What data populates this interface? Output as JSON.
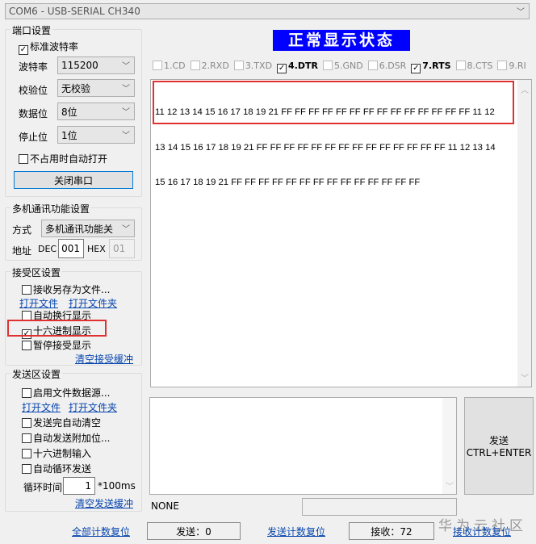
{
  "port_combo": "COM6 - USB-SERIAL CH340",
  "status_banner": "正常显示状态",
  "colors": {
    "banner_bg": "#0000ff",
    "banner_fg": "#ffffff",
    "highlight": "#e03030",
    "link": "#0645ad"
  },
  "signals": [
    {
      "label": "1.CD",
      "checked": false
    },
    {
      "label": "2.RXD",
      "checked": false
    },
    {
      "label": "3.TXD",
      "checked": false
    },
    {
      "label": "4.DTR",
      "checked": true
    },
    {
      "label": "5.GND",
      "checked": false
    },
    {
      "label": "6.DSR",
      "checked": false
    },
    {
      "label": "7.RTS",
      "checked": true
    },
    {
      "label": "8.CTS",
      "checked": false
    },
    {
      "label": "9.RI",
      "checked": false
    }
  ],
  "rx_lines": [
    "11 12 13 14 15 16 17 18 19 21 FF FF FF FF FF FF FF FF FF FF FF FF FF FF 11 12",
    "13 14 15 16 17 18 19 21 FF FF FF FF FF FF FF FF FF FF FF FF FF FF 11 12 13 14",
    "15 16 17 18 19 21 FF FF FF FF FF FF FF FF FF FF FF FF FF FF"
  ],
  "port": {
    "title": "端口设置",
    "std_baud": "标准波特率",
    "baud_label": "波特率",
    "baud": "115200",
    "parity_label": "校验位",
    "parity": "无校验",
    "data_label": "数据位",
    "data": "8位",
    "stop_label": "停止位",
    "stop": "1位",
    "auto_open": "不占用时自动打开",
    "close_btn": "关闭串口"
  },
  "multi": {
    "title": "多机通讯功能设置",
    "mode_label": "方式",
    "mode": "多机通讯功能关",
    "addr_label": "地址",
    "dec_label": "DEC",
    "dec": "001",
    "hex_label": "HEX",
    "hex": "01"
  },
  "recv": {
    "title": "接受区设置",
    "save_file": "接收另存为文件...",
    "open_file": "打开文件",
    "open_folder": "打开文件夹",
    "auto_wrap": "自动换行显示",
    "hex_display": "十六进制显示",
    "pause": "暂停接受显示",
    "clear": "清空接受缓冲"
  },
  "send": {
    "title": "发送区设置",
    "file_src": "启用文件数据源...",
    "open_file": "打开文件",
    "open_folder": "打开文件夹",
    "auto_clear": "发送完自动清空",
    "auto_append": "自动发送附加位...",
    "hex_input": "十六进制输入",
    "auto_loop": "自动循环发送",
    "loop_label": "循环时间",
    "loop_value": "1",
    "loop_unit": "*100ms",
    "clear": "清空发送缓冲",
    "send_btn_1": "发送",
    "send_btn_2": "CTRL+ENTER"
  },
  "status": {
    "none": "NONE",
    "reset_all": "全部计数复位",
    "sent": "发送：0",
    "reset_sent": "发送计数复位",
    "recv": "接收：72",
    "reset_recv": "接收计数复位"
  },
  "watermark": "华为云社区"
}
